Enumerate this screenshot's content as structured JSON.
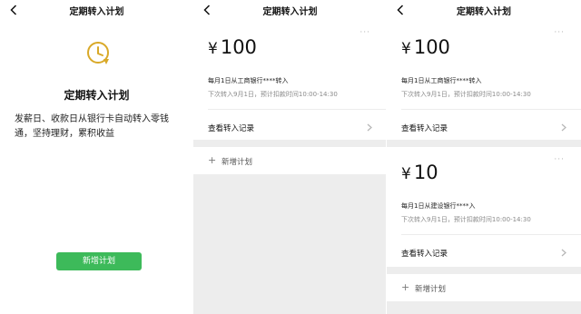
{
  "screens": [
    {
      "nav_title": "定期转入计划",
      "intro": {
        "icon": "clock-icon",
        "title": "定期转入计划",
        "description": "发薪日、收款日从银行卡自动转入零钱通，坚持理财，累积收益",
        "button_label": "新增计划",
        "button_color": "#3dba5a",
        "accent_color": "#d9a928"
      }
    },
    {
      "nav_title": "定期转入计划",
      "plans": [
        {
          "currency": "¥",
          "amount": "100",
          "description": "每月1日从工商银行****转入",
          "next": "下次转入9月1日，预计扣款时间10:00-14:30",
          "record_label": "查看转入记录"
        }
      ],
      "add_label": "新增计划"
    },
    {
      "nav_title": "定期转入计划",
      "plans": [
        {
          "currency": "¥",
          "amount": "100",
          "description": "每月1日从工商银行****转入",
          "next": "下次转入9月1日，预计扣款时间10:00-14:30",
          "record_label": "查看转入记录"
        },
        {
          "currency": "¥",
          "amount": "10",
          "description": "每月1日从建设银行****入",
          "next": "下次转入9月1日，预计扣款时间10:00-14:30",
          "record_label": "查看转入记录"
        }
      ],
      "add_label": "新增计划"
    }
  ]
}
